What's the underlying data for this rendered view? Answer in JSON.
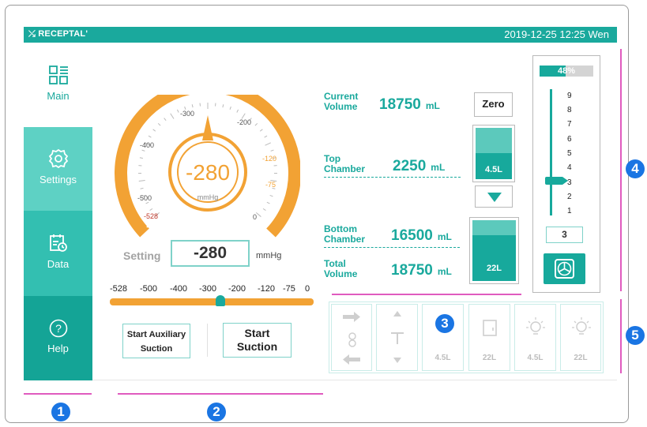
{
  "topbar": {
    "brand": "RECEPTAL",
    "datetime": "2019-12-25   12:25   Wen"
  },
  "sidebar": {
    "items": [
      {
        "label": "Main",
        "icon": "dashboard-icon"
      },
      {
        "label": "Settings",
        "icon": "gear-icon"
      },
      {
        "label": "Data",
        "icon": "calendar-clock-icon"
      },
      {
        "label": "Help",
        "icon": "question-icon"
      }
    ]
  },
  "gauge": {
    "value": "-280",
    "unit": "mmHg",
    "current_level": -280,
    "ticks": [
      "-528",
      "-500",
      "-400",
      "-300",
      "-200",
      "-120",
      "-75",
      "0"
    ]
  },
  "setting": {
    "label": "Setting",
    "value": "-280",
    "unit": "mmHg"
  },
  "scale": {
    "ticks": [
      "-528",
      "-500",
      "-400",
      "-300",
      "-200",
      "-120",
      "-75",
      "0"
    ],
    "position_value": -280
  },
  "buttons": {
    "aux_line1": "Start Auxiliary",
    "aux_line2": "Suction",
    "start_line1": "Start",
    "start_line2": "Suction"
  },
  "volumes": {
    "current": {
      "label1": "Current",
      "label2": "Volume",
      "value": "18750",
      "unit": "mL"
    },
    "top": {
      "label1": "Top",
      "label2": "Chamber",
      "value": "2250",
      "unit": "mL"
    },
    "bottom": {
      "label1": "Bottom",
      "label2": "Chamber",
      "value": "16500",
      "unit": "mL"
    },
    "total": {
      "label1": "Total",
      "label2": "Volume",
      "value": "18750",
      "unit": "mL"
    },
    "zero_label": "Zero"
  },
  "chambers": {
    "top": {
      "capacity": "4.5L",
      "fill_fraction": 0.5
    },
    "bottom": {
      "capacity": "22L",
      "fill_fraction": 0.75
    }
  },
  "level": {
    "percent": "48%",
    "percent_value": 0.48,
    "numbers": [
      "9",
      "8",
      "7",
      "6",
      "5",
      "4",
      "3",
      "2",
      "1"
    ],
    "selected": "3"
  },
  "button_group": {
    "captions": [
      "4.5L",
      "22L",
      "4.5L",
      "22L"
    ]
  },
  "badges": [
    "1",
    "2",
    "3",
    "4",
    "5"
  ],
  "colors": {
    "accent": "#1aa99d",
    "gauge": "#f2a234",
    "annotation": "#e05bbf",
    "badge": "#1a75e3"
  }
}
